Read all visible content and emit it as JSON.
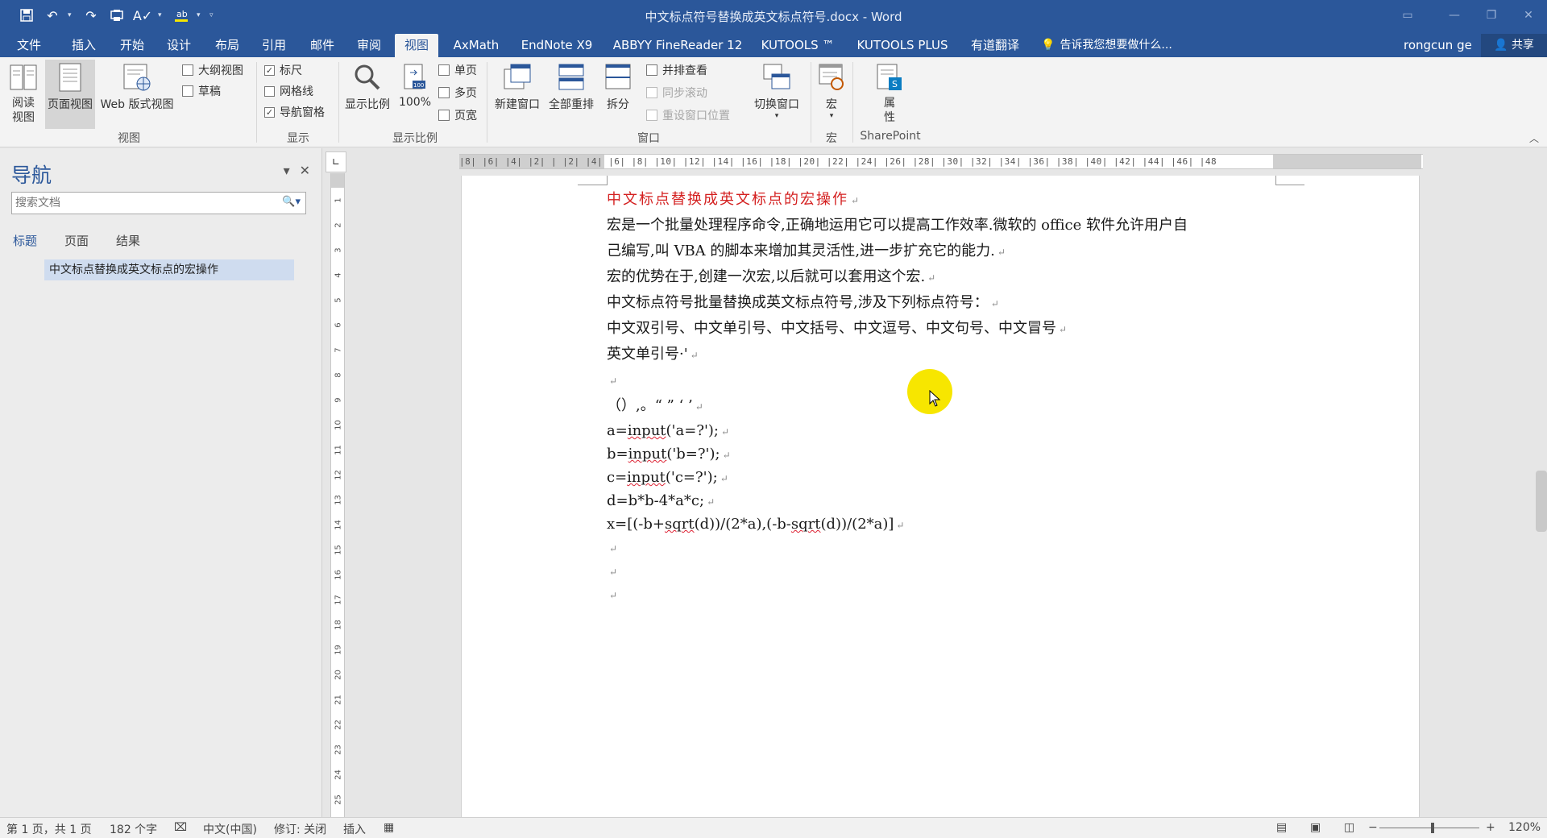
{
  "window": {
    "title": "中文标点符号替换成英文标点符号.docx - Word",
    "controls": [
      "ribbon-display-icon",
      "minimize-icon",
      "restore-icon",
      "close-icon"
    ]
  },
  "quick_access": {
    "icons": [
      "save-icon",
      "undo-icon",
      "redo-icon",
      "print-preview-icon",
      "spelling-icon",
      "highlight-icon",
      "customize-icon"
    ]
  },
  "tabs": [
    "文件",
    "插入",
    "开始",
    "设计",
    "布局",
    "引用",
    "邮件",
    "审阅",
    "视图",
    "AxMath",
    "EndNote X9",
    "ABBYY FineReader 12",
    "KUTOOLS ™",
    "KUTOOLS PLUS",
    "有道翻译"
  ],
  "active_tab": "视图",
  "tell_me": "告诉我您想要做什么...",
  "user": "rongcun ge",
  "share": "共享",
  "ribbon": {
    "views": {
      "read_mode": "阅读\n视图",
      "print_layout": "页面视图",
      "web_layout": "Web 版式视图",
      "outline": "大纲视图",
      "draft": "草稿",
      "group": "视图"
    },
    "show": {
      "ruler": "标尺",
      "gridlines": "网格线",
      "nav_pane": "导航窗格",
      "group": "显示",
      "ruler_checked": true,
      "gridlines_checked": false,
      "nav_checked": true
    },
    "zoom": {
      "zoom": "显示比例",
      "hundred": "100%",
      "one_page": "单页",
      "multi_page": "多页",
      "page_width": "页宽",
      "group": "显示比例"
    },
    "window": {
      "new_window": "新建窗口",
      "arrange_all": "全部重排",
      "split": "拆分",
      "side_by_side": "并排查看",
      "sync_scroll": "同步滚动",
      "reset_position": "重设窗口位置",
      "switch_windows": "切换窗口",
      "group": "窗口"
    },
    "macros": {
      "macros": "宏",
      "group": "宏"
    },
    "sharepoint": {
      "properties": "属\n性",
      "group": "SharePoint"
    }
  },
  "nav": {
    "title": "导航",
    "search_placeholder": "搜索文档",
    "tabs": [
      "标题",
      "页面",
      "结果"
    ],
    "headings": [
      "中文标点替换成英文标点的宏操作"
    ]
  },
  "ruler": {
    "h_numbers": "|8| |6| |4| |2| | |2| |4| |6| |8| |10| |12| |14| |16| |18| |20| |22| |24| |26| |28| |30| |32| |34| |36| |38| |40| |42| |44| |46| |48",
    "v_numbers": [
      "1",
      "2",
      "3",
      "4",
      "5",
      "6",
      "7",
      "8",
      "9",
      "10",
      "11",
      "12",
      "13",
      "14",
      "15",
      "16",
      "17",
      "18",
      "19",
      "20",
      "21",
      "22",
      "23",
      "24",
      "25"
    ]
  },
  "document": {
    "title": "中文标点替换成英文标点的宏操作",
    "paragraphs": [
      "宏是一个批量处理程序命令,正确地运用它可以提高工作效率.微软的 office 软件允许用户自",
      "己编写,叫 VBA 的脚本来增加其灵活性,进一步扩充它的能力.",
      "宏的优势在于,创建一次宏,以后就可以套用这个宏.",
      "中文标点符号批量替换成英文标点符号,涉及下列标点符号：",
      "中文双引号、中文单引号、中文括号、中文逗号、中文句号、中文冒号",
      "英文单引号·'",
      "",
      "（）,。“ ” ‘ ’",
      "a=input('a=?');",
      "b=input('b=?');",
      "c=input('c=?');",
      "d=b*b-4*a*c;",
      "x=[(-b+sqrt(d))/(2*a),(-b-sqrt(d))/(2*a)]",
      "",
      "",
      ""
    ],
    "paragraph_mark": "↵"
  },
  "status": {
    "page": "第 1 页，共 1 页",
    "words": "182 个字",
    "language": "中文(中国)",
    "track": "修订: 关闭",
    "insert": "插入",
    "zoom": "120%"
  }
}
